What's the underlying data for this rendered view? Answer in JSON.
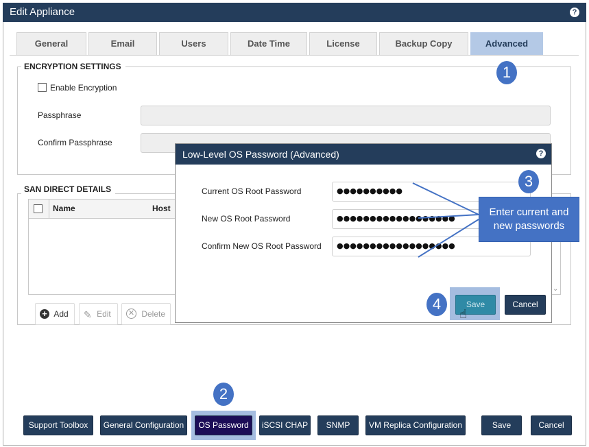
{
  "window": {
    "title": "Edit Appliance",
    "help": "?"
  },
  "tabs": [
    {
      "label": "General"
    },
    {
      "label": "Email"
    },
    {
      "label": "Users"
    },
    {
      "label": "Date Time"
    },
    {
      "label": "License"
    },
    {
      "label": "Backup Copy"
    },
    {
      "label": "Advanced"
    }
  ],
  "encryption": {
    "legend": "ENCRYPTION SETTINGS",
    "enable_label": "Enable Encryption",
    "enabled": false,
    "passphrase_label": "Passphrase",
    "confirm_label": "Confirm Passphrase"
  },
  "san": {
    "legend": "SAN DIRECT DETAILS",
    "columns": [
      "Name",
      "Host"
    ],
    "add_label": "Add",
    "edit_label": "Edit",
    "delete_label": "Delete"
  },
  "dialog": {
    "title": "Low-Level OS Password (Advanced)",
    "help": "?",
    "current_label": "Current OS Root Password",
    "current_value": "●●●●●●●●●●",
    "new_label": "New OS Root Password",
    "new_value": "●●●●●●●●●●●●●●●●●●",
    "confirm_label": "Confirm New OS Root Password",
    "confirm_value": "●●●●●●●●●●●●●●●●●●",
    "save_label": "Save",
    "cancel_label": "Cancel"
  },
  "callouts": {
    "one": "1",
    "two": "2",
    "three": "3",
    "four": "4",
    "note": "Enter current and new passwords"
  },
  "footer": {
    "support_toolbox": "Support Toolbox",
    "general_config": "General Configuration",
    "os_password": "OS Password",
    "iscsi_chap": "iSCSI CHAP",
    "snmp": "SNMP",
    "vm_replica": "VM Replica Configuration",
    "save": "Save",
    "cancel": "Cancel"
  },
  "colors": {
    "navy": "#243d5b",
    "callout_blue": "#4472c4",
    "active_tab": "#b4c9e6",
    "highlight": "#a5bde0",
    "os_password_btn": "#1c0d57",
    "dialog_save": "#2f8aa6"
  }
}
